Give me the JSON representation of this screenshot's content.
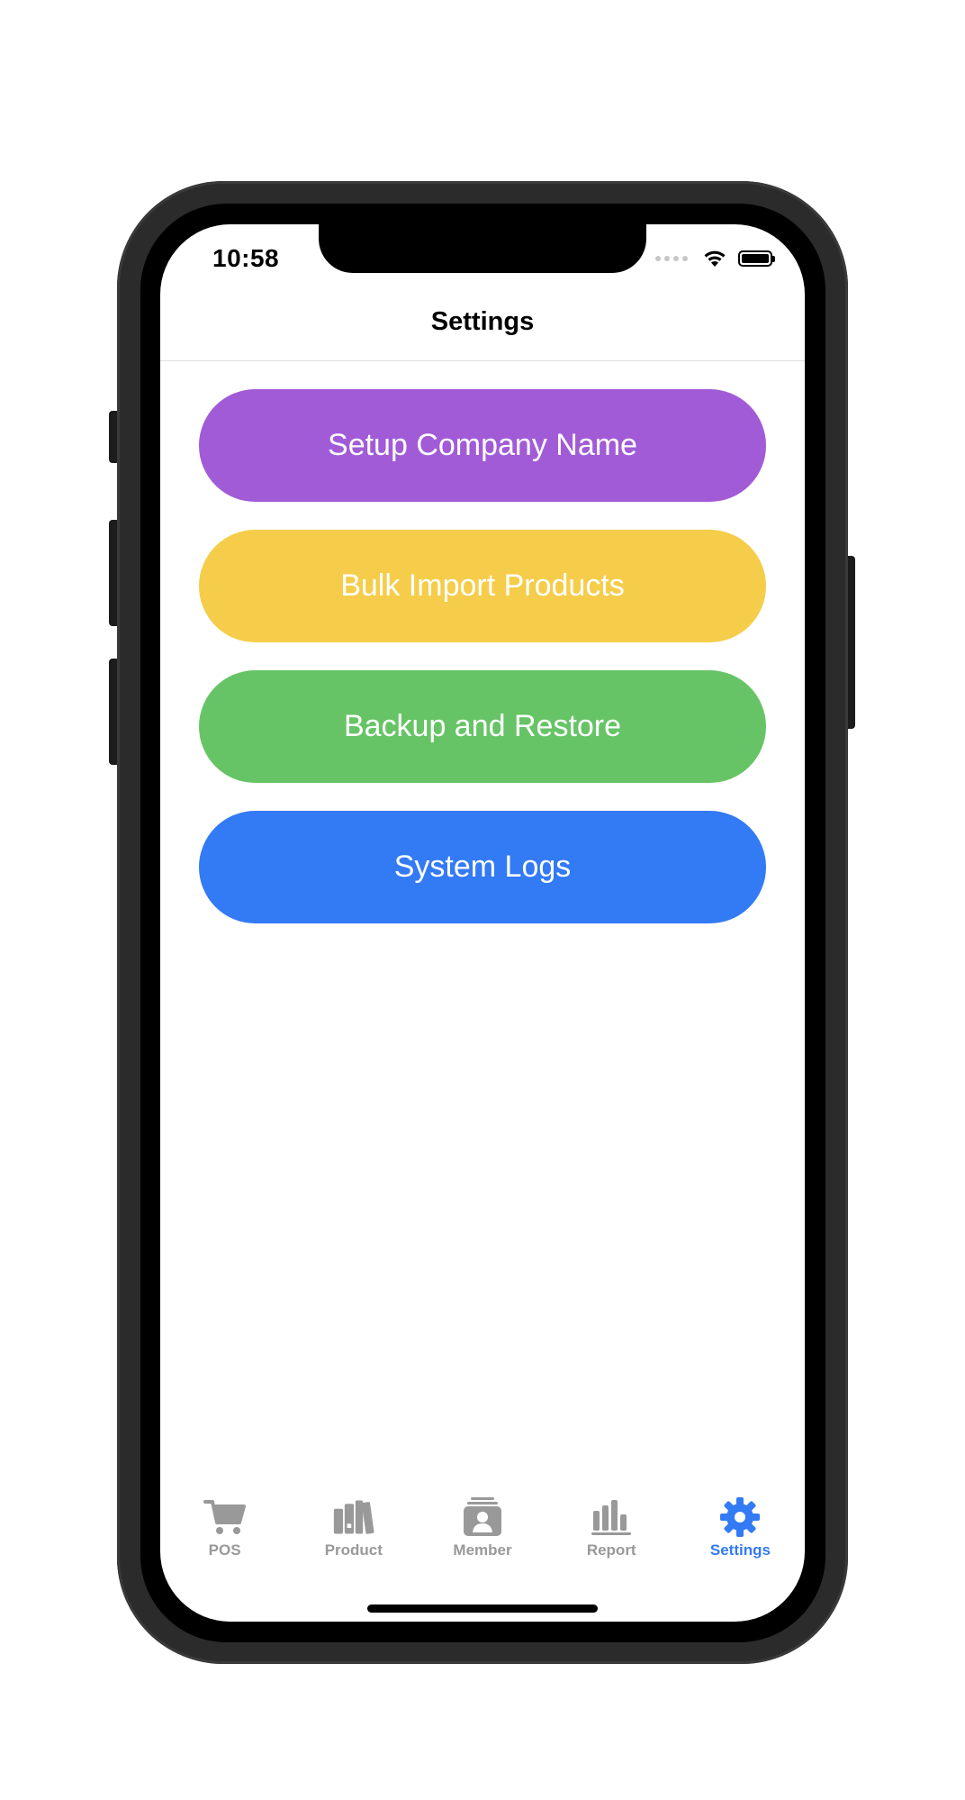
{
  "status_bar": {
    "time": "10:58"
  },
  "nav": {
    "title": "Settings"
  },
  "menu": [
    {
      "label": "Setup Company Name",
      "color": "#A25BD7"
    },
    {
      "label": "Bulk Import Products",
      "color": "#F5CD4A"
    },
    {
      "label": "Backup and Restore",
      "color": "#67C466"
    },
    {
      "label": "System Logs",
      "color": "#337AF5"
    }
  ],
  "tabs": [
    {
      "label": "POS",
      "icon": "cart-icon",
      "active": false
    },
    {
      "label": "Product",
      "icon": "books-icon",
      "active": false
    },
    {
      "label": "Member",
      "icon": "contact-card-icon",
      "active": false
    },
    {
      "label": "Report",
      "icon": "bar-chart-icon",
      "active": false
    },
    {
      "label": "Settings",
      "icon": "gear-icon",
      "active": true
    }
  ],
  "colors": {
    "tab_inactive": "#999999",
    "tab_active": "#337AF5"
  }
}
